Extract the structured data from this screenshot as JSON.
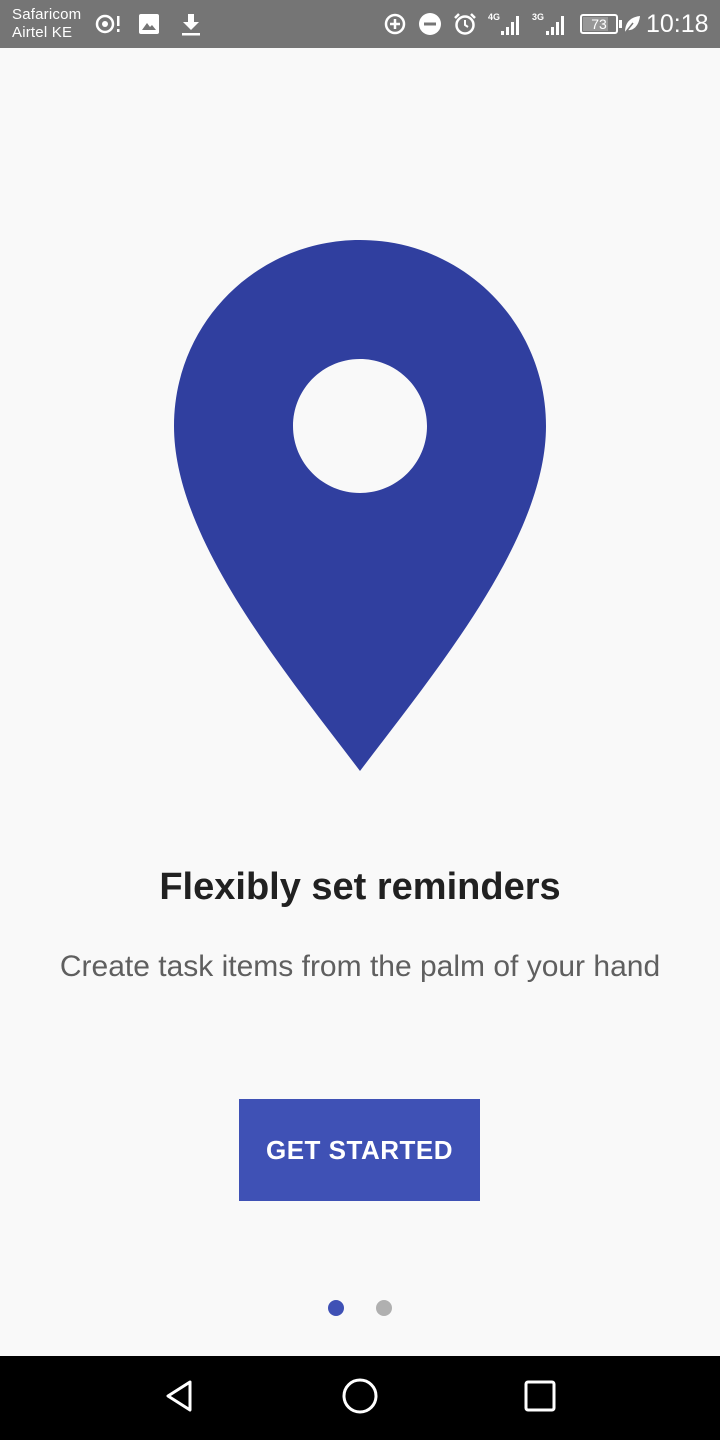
{
  "status_bar": {
    "carrier_1": "Safaricom",
    "carrier_2": "Airtel KE",
    "network_1": "4G",
    "network_2": "3G",
    "battery_level": "73",
    "time": "10:18",
    "left_icons": [
      "hotspot-icon",
      "image-icon",
      "download-icon"
    ],
    "right_icons": [
      "data-saver-icon",
      "do-not-disturb-icon",
      "alarm-icon",
      "signal-icon",
      "signal-icon",
      "battery-icon",
      "power-saving-leaf-icon"
    ]
  },
  "onboarding": {
    "illustration_icon": "location-pin-icon",
    "title": "Flexibly set reminders",
    "subtitle": "Create task items from the palm of your hand",
    "cta_label": "GET STARTED",
    "page_count": 2,
    "current_page": 1
  },
  "nav_bar": {
    "icons": [
      "back-icon",
      "home-icon",
      "recents-icon"
    ]
  },
  "colors": {
    "status_bar_bg": "#757575",
    "background": "#f9f9f9",
    "pin": "#303f9f",
    "button": "#3f51b5",
    "indicator_active": "#3f51b5",
    "indicator_inactive": "#b0b0b0",
    "title_text": "#212121",
    "subtitle_text": "#5f5f5f",
    "nav_bar_bg": "#000000"
  }
}
